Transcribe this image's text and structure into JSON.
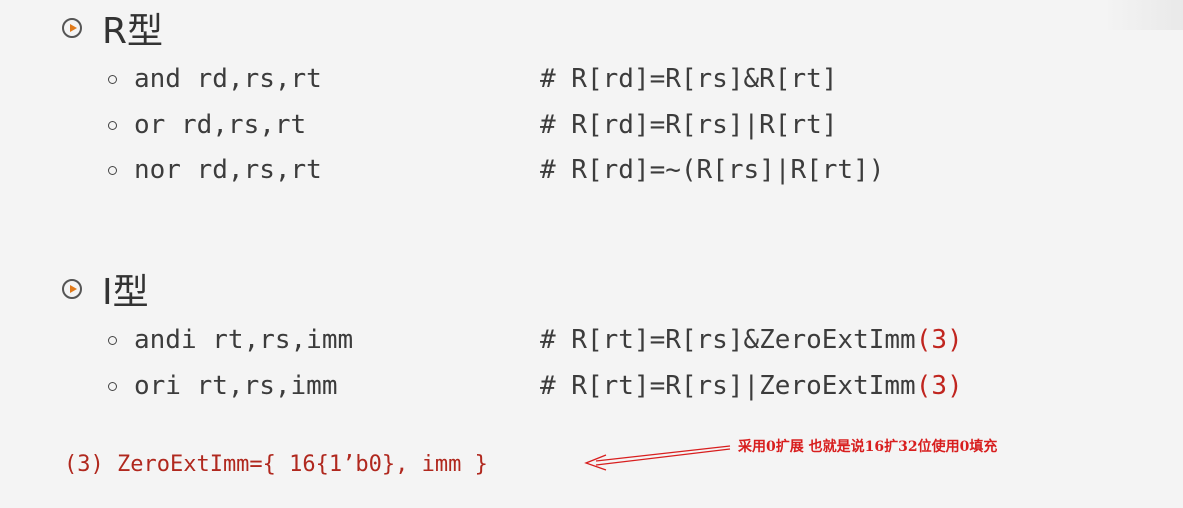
{
  "sections": [
    {
      "title": "R型",
      "lines": [
        {
          "instr": "and rd,rs,rt",
          "comment": "# R[rd]=R[rs]&R[rt]",
          "comment_suffix": ""
        },
        {
          "instr": "or rd,rs,rt",
          "comment": "# R[rd]=R[rs]|R[rt]",
          "comment_suffix": ""
        },
        {
          "instr": "nor rd,rs,rt",
          "comment": "# R[rd]=~(R[rs]|R[rt])",
          "comment_suffix": ""
        }
      ]
    },
    {
      "title": "I型",
      "lines": [
        {
          "instr": "andi rt,rs,imm",
          "comment": "# R[rt]=R[rs]&ZeroExtImm",
          "comment_suffix": "(3)"
        },
        {
          "instr": "ori rt,rs,imm",
          "comment": "# R[rt]=R[rs]|ZeroExtImm",
          "comment_suffix": "(3)"
        }
      ]
    }
  ],
  "footnote": "(3) ZeroExtImm={ 16{1’b0}, imm }",
  "annotation": "采用0扩展  也就是说16扩32位使用0填充",
  "colors": {
    "text": "#3c3c3c",
    "accent_red": "#c0251f",
    "annotation_red": "#d81e1e",
    "bullet_orange": "#e07a1a",
    "background": "#f4f4f4"
  },
  "icons": {
    "section_bullet": "play-circle-icon",
    "item_bullet": "hollow-circle-bullet-icon"
  }
}
